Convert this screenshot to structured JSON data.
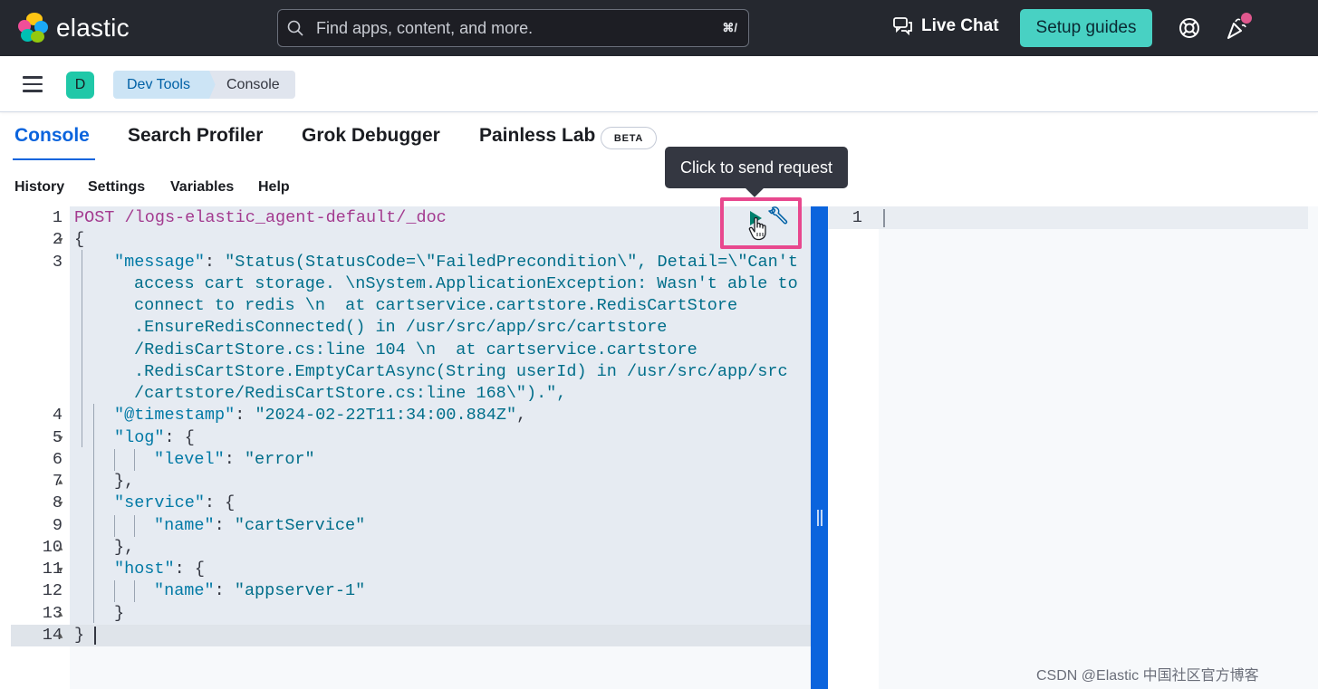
{
  "header": {
    "brand": "elastic",
    "search_placeholder": "Find apps, content, and more.",
    "search_shortcut": "⌘/",
    "live_chat": "Live Chat",
    "setup_guides": "Setup guides"
  },
  "breadcrumb": {
    "space_initial": "D",
    "items": [
      "Dev Tools",
      "Console"
    ]
  },
  "tabs": [
    {
      "label": "Console",
      "active": true
    },
    {
      "label": "Search Profiler",
      "active": false
    },
    {
      "label": "Grok Debugger",
      "active": false
    },
    {
      "label": "Painless Lab",
      "active": false,
      "badge": "BETA"
    }
  ],
  "console_menu": [
    "History",
    "Settings",
    "Variables",
    "Help"
  ],
  "tooltip": "Click to send request",
  "editor": {
    "line_numbers": [
      "1",
      "2",
      "3",
      "4",
      "5",
      "6",
      "7",
      "8",
      "9",
      "10",
      "11",
      "12",
      "13",
      "14"
    ],
    "request_method": "POST",
    "request_path": "/logs-elastic_agent-default/_doc",
    "message_key": "\"message\"",
    "message_value_lines": [
      "\"Status(StatusCode=\\\"FailedPrecondition\\\", Detail=\\\"Can't",
      "access cart storage. \\nSystem.ApplicationException: Wasn't able to",
      "connect to redis \\n  at cartservice.cartstore.RedisCartStore",
      ".EnsureRedisConnected() in /usr/src/app/src/cartstore",
      "/RedisCartStore.cs:line 104 \\n  at cartservice.cartstore",
      ".RedisCartStore.EmptyCartAsync(String userId) in /usr/src/app/src",
      "/cartstore/RedisCartStore.cs:line 168\\\").\","
    ],
    "timestamp_key": "\"@timestamp\"",
    "timestamp_value": "\"2024-02-22T11:34:00.884Z\"",
    "log_key": "\"log\"",
    "level_key": "\"level\"",
    "level_value": "\"error\"",
    "service_key": "\"service\"",
    "service_name_key": "\"name\"",
    "service_name_value": "\"cartService\"",
    "host_key": "\"host\"",
    "host_name_key": "\"name\"",
    "host_name_value": "\"appserver-1\""
  },
  "output": {
    "line_numbers": [
      "1"
    ]
  },
  "watermark": "CSDN @Elastic 中国社区官方博客",
  "colors": {
    "header_bg": "#25282f",
    "accent": "#0b64dd",
    "setup_button": "#48d1c3",
    "highlight_box": "#e8488e",
    "play_button": "#00806e"
  }
}
